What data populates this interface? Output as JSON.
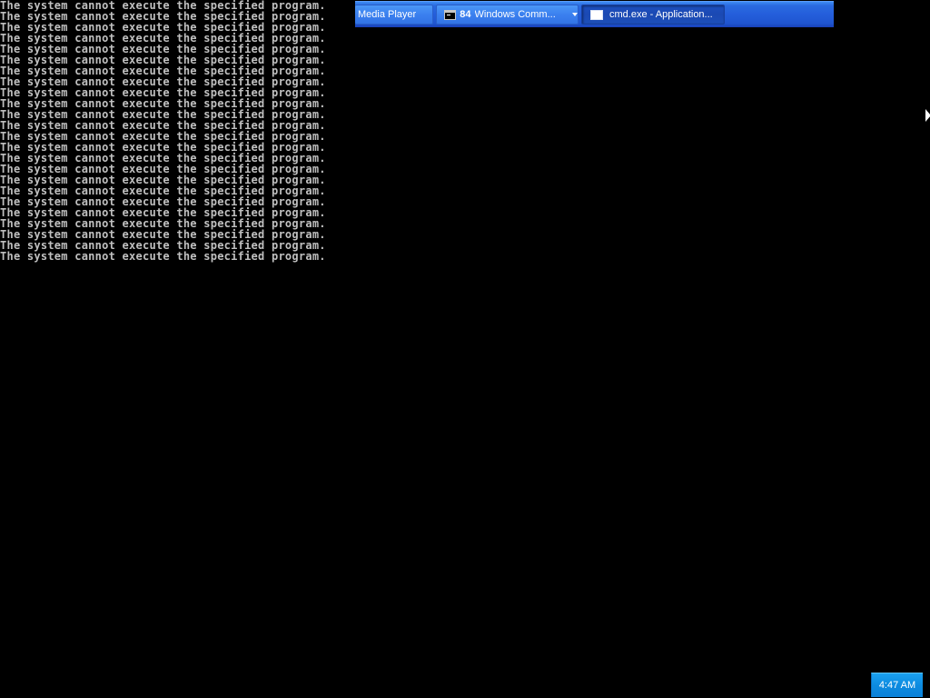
{
  "console": {
    "lines": [
      "The system cannot execute the specified program.",
      "The system cannot execute the specified program.",
      "The system cannot execute the specified program.",
      "The system cannot execute the specified program.",
      "The system cannot execute the specified program.",
      "The system cannot execute the specified program.",
      "The system cannot execute the specified program.",
      "The system cannot execute the specified program.",
      "The system cannot execute the specified program.",
      "The system cannot execute the specified program.",
      "The system cannot execute the specified program.",
      "The system cannot execute the specified program.",
      "The system cannot execute the specified program.",
      "The system cannot execute the specified program.",
      "The system cannot execute the specified program.",
      "The system cannot execute the specified program.",
      "The system cannot execute the specified program.",
      "The system cannot execute the specified program.",
      "The system cannot execute the specified program.",
      "The system cannot execute the specified program.",
      "The system cannot execute the specified program.",
      "The system cannot execute the specified program.",
      "The system cannot execute the specified program.",
      "The system cannot execute the specified program."
    ]
  },
  "taskbar": {
    "buttons": [
      {
        "label": "Media Player"
      },
      {
        "icon": "cmd-icon",
        "count": "84",
        "label": "Windows Comm..."
      },
      {
        "icon": "window-icon",
        "label": "cmd.exe - Application..."
      }
    ]
  },
  "clock": {
    "time": "4:47 AM"
  },
  "colors": {
    "console_text": "#c0c0c0",
    "console_background": "#000000",
    "taskbar_blue": "#245edb",
    "clock_blue": "#0c8be0"
  }
}
